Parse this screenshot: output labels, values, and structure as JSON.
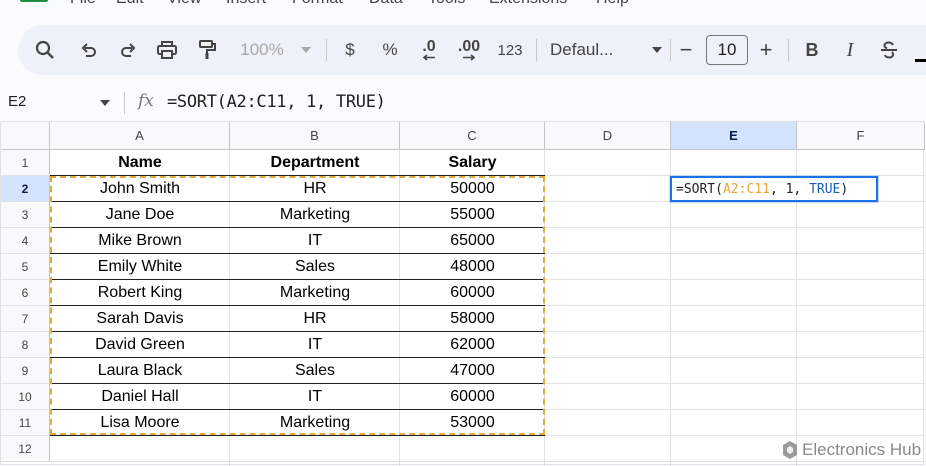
{
  "menu": {
    "items": [
      "File",
      "Edit",
      "View",
      "Insert",
      "Format",
      "Data",
      "Tools",
      "Extensions",
      "Help"
    ]
  },
  "toolbar": {
    "zoom": "100%",
    "currency": "$",
    "percent": "%",
    "decrease_decimals": ".0",
    "increase_decimals": ".00",
    "number_format": "123",
    "font": "Defaul...",
    "font_size": "10",
    "minus": "−",
    "plus": "+",
    "bold": "B",
    "italic": "I"
  },
  "formula_bar": {
    "name_box": "E2",
    "fx": "fx",
    "formula": "=SORT(A2:C11, 1, TRUE)"
  },
  "sheet": {
    "columns": [
      "A",
      "B",
      "C",
      "D",
      "E",
      "F"
    ],
    "rows": [
      "1",
      "2",
      "3",
      "4",
      "5",
      "6",
      "7",
      "8",
      "9",
      "10",
      "11",
      "12"
    ],
    "headers": [
      "Name",
      "Department",
      "Salary"
    ],
    "data": [
      [
        "John Smith",
        "HR",
        "50000"
      ],
      [
        "Jane Doe",
        "Marketing",
        "55000"
      ],
      [
        "Mike Brown",
        "IT",
        "65000"
      ],
      [
        "Emily White",
        "Sales",
        "48000"
      ],
      [
        "Robert King",
        "Marketing",
        "60000"
      ],
      [
        "Sarah Davis",
        "HR",
        "58000"
      ],
      [
        "David Green",
        "IT",
        "62000"
      ],
      [
        "Laura Black",
        "Sales",
        "47000"
      ],
      [
        "Daniel Hall",
        "IT",
        "60000"
      ],
      [
        "Lisa Moore",
        "Marketing",
        "53000"
      ]
    ],
    "active_cell": {
      "func": "=SORT(",
      "range": "A2:C11",
      "args": ", 1, ",
      "keyword": "TRUE",
      "close": ")"
    }
  },
  "watermark": {
    "text": "Electronics Hub"
  },
  "colors": {
    "accent": "#1a73e8",
    "selection_header": "#d3e3fd",
    "copy_border": "#e0a93a",
    "toolbar_bg": "#edf2fa"
  }
}
